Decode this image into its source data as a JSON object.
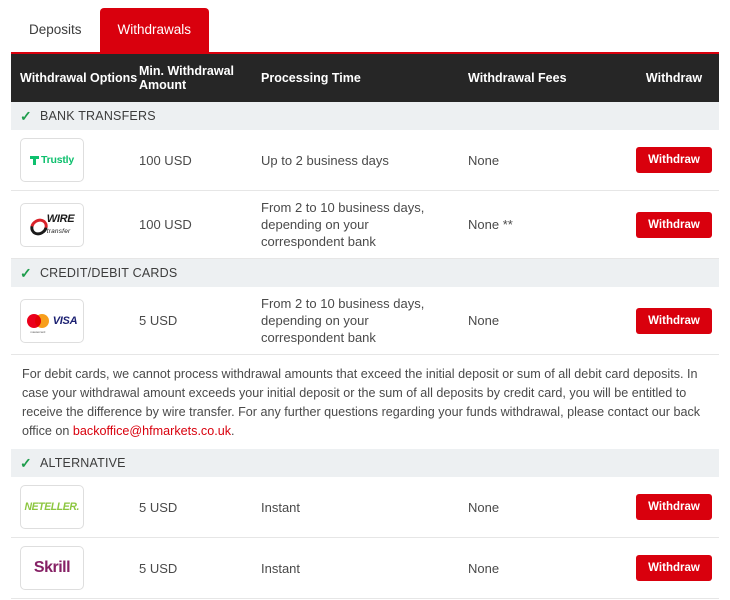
{
  "tabs": [
    {
      "label": "Deposits",
      "active": false
    },
    {
      "label": "Withdrawals",
      "active": true
    }
  ],
  "table": {
    "headers": {
      "options": "Withdrawal Options",
      "amount": "Min. Withdrawal Amount",
      "time": "Processing Time",
      "fees": "Withdrawal Fees",
      "withdraw": "Withdraw"
    },
    "sections": [
      {
        "title": "BANK TRANSFERS",
        "check_icon": "check-icon",
        "rows": [
          {
            "logo": "trustly-logo",
            "logo_text": "Trustly",
            "amount": "100 USD",
            "time": "Up to 2 business days",
            "fees": "None",
            "button": "Withdraw"
          },
          {
            "logo": "wire-transfer-logo",
            "logo_text": "WIRE transfer",
            "amount": "100 USD",
            "time": "From 2 to 10 business days, depending on your correspondent bank",
            "fees": "None **",
            "button": "Withdraw"
          }
        ]
      },
      {
        "title": "CREDIT/DEBIT CARDS",
        "check_icon": "check-icon",
        "rows": [
          {
            "logo": "mastercard-visa-logo",
            "logo_text": "mastercard VISA",
            "amount": "5 USD",
            "time": "From 2 to 10 business days, depending on your correspondent bank",
            "fees": "None",
            "button": "Withdraw"
          }
        ]
      },
      {
        "title": "ALTERNATIVE",
        "check_icon": "check-icon",
        "rows": [
          {
            "logo": "neteller-logo",
            "logo_text": "NETELLER",
            "amount": "5 USD",
            "time": "Instant",
            "fees": "None",
            "button": "Withdraw"
          },
          {
            "logo": "skrill-logo",
            "logo_text": "Skrill",
            "amount": "5 USD",
            "time": "Instant",
            "fees": "None",
            "button": "Withdraw"
          }
        ]
      }
    ]
  },
  "disclaimer": {
    "text_before": "For debit cards, we cannot process withdrawal amounts that exceed the initial deposit or sum of all debit card deposits. In case your withdrawal amount exceeds your initial deposit or the sum of all deposits by credit card, you will be entitled to receive the difference by wire transfer. For any further questions regarding your funds withdrawal, please contact our back office on ",
    "email": "backoffice@hfmarkets.co.uk",
    "text_after": "."
  },
  "colors": {
    "brand_red": "#d9000d",
    "header_dark": "#262626",
    "band_gray": "#edf0f2",
    "check_green": "#1f9d4d",
    "link_red": "#d9000d"
  }
}
